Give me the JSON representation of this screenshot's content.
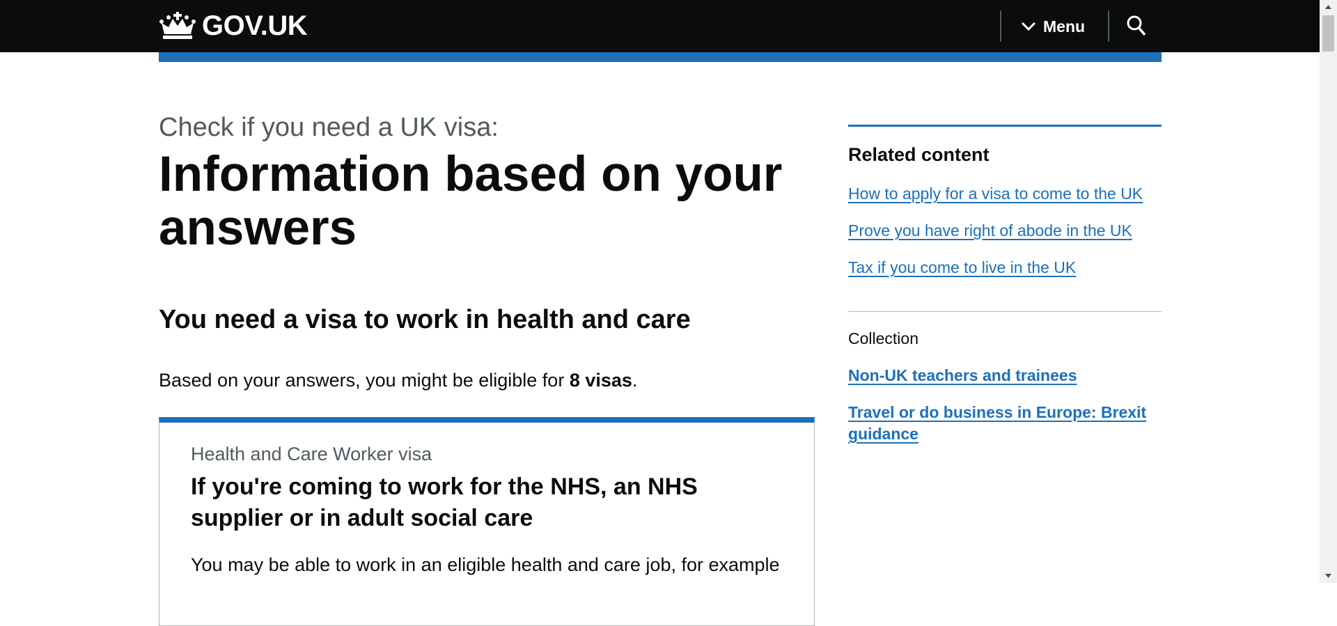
{
  "header": {
    "logo_text": "GOV.UK",
    "menu_label": "Menu",
    "search_icon": "search-icon",
    "background": "#0b0c0c",
    "accent": "#1d70b8"
  },
  "main": {
    "caption": "Check if you need a UK visa:",
    "title": "Information based on your answers",
    "result_heading": "You need a visa to work in health and care",
    "eligible_prefix": "Based on your answers, you might be eligible for ",
    "eligible_count": "8 visas",
    "eligible_suffix": ".",
    "visa_card": {
      "caption": "Health and Care Worker visa",
      "title": "If you're coming to work for the NHS, an NHS supplier or in adult social care",
      "body": "You may be able to work in an eligible health and care job, for example"
    }
  },
  "sidebar": {
    "related_heading": "Related content",
    "related_links": [
      "How to apply for a visa to come to the UK",
      "Prove you have right of abode in the UK",
      "Tax if you come to live in the UK"
    ],
    "collection_label": "Collection",
    "collection_links": [
      "Non-UK teachers and trainees",
      "Travel or do business in Europe: Brexit guidance"
    ]
  }
}
